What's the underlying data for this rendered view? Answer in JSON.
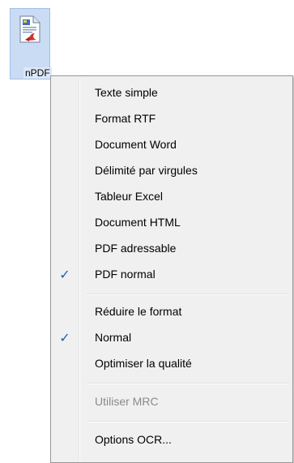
{
  "desktop_icon": {
    "label": "nPDF",
    "icon": "pdf-document-icon"
  },
  "menu": {
    "group1": [
      {
        "label": "Texte simple",
        "checked": false
      },
      {
        "label": "Format RTF",
        "checked": false
      },
      {
        "label": "Document Word",
        "checked": false
      },
      {
        "label": "Délimité par virgules",
        "checked": false
      },
      {
        "label": "Tableur Excel",
        "checked": false
      },
      {
        "label": "Document HTML",
        "checked": false
      },
      {
        "label": "PDF adressable",
        "checked": false
      },
      {
        "label": "PDF normal",
        "checked": true
      }
    ],
    "group2": [
      {
        "label": "Réduire le format",
        "checked": false
      },
      {
        "label": "Normal",
        "checked": true
      },
      {
        "label": "Optimiser la qualité",
        "checked": false
      }
    ],
    "group3": [
      {
        "label": "Utiliser MRC",
        "disabled": true
      }
    ],
    "group4": [
      {
        "label": "Options OCR..."
      }
    ],
    "check_glyph": "✓",
    "accent_color": "#1f5fb8"
  }
}
